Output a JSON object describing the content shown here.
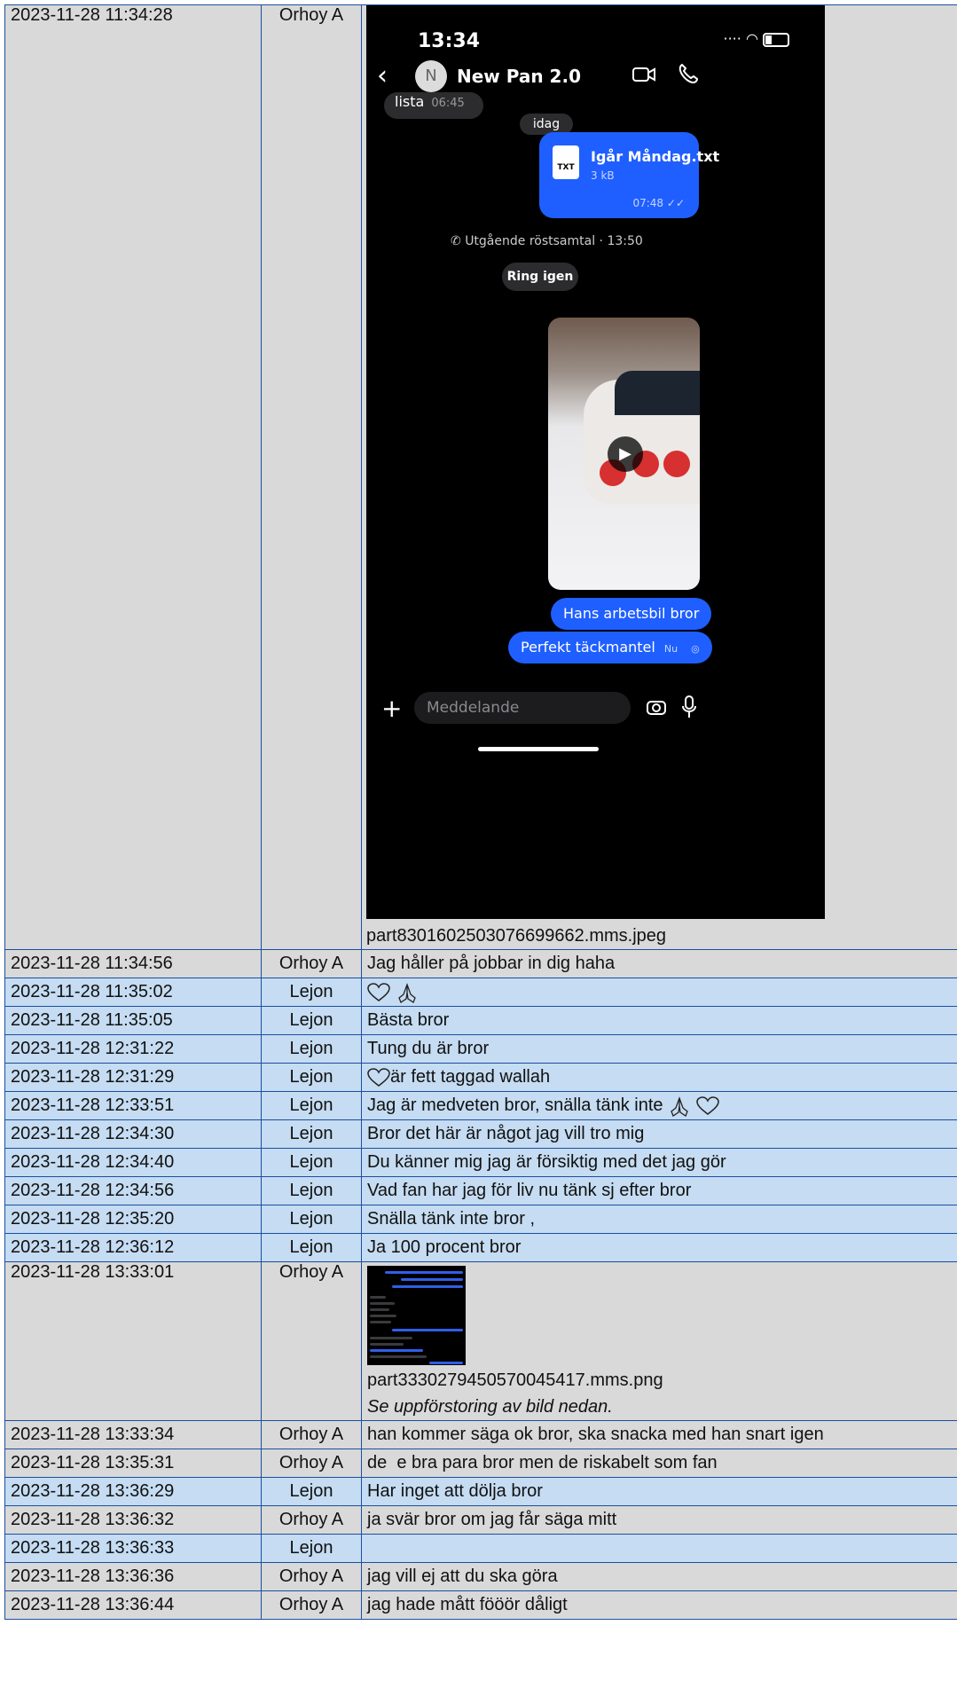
{
  "rows": [
    {
      "time": "2023-11-28 11:34:28",
      "sender": "Orhoy A",
      "text": "part8301602503076699662.mms.jpeg"
    },
    {
      "time": "2023-11-28 11:34:56",
      "sender": "Orhoy A",
      "text": "Jag håller på jobbar in dig haha"
    },
    {
      "time": "2023-11-28 11:35:02",
      "sender": "Lejon",
      "text": ""
    },
    {
      "time": "2023-11-28 11:35:05",
      "sender": "Lejon",
      "text": "Bästa bror"
    },
    {
      "time": "2023-11-28 12:31:22",
      "sender": "Lejon",
      "text": "Tung du är bror"
    },
    {
      "time": "2023-11-28 12:31:29",
      "sender": "Lejon",
      "text": "är fett taggad wallah"
    },
    {
      "time": "2023-11-28 12:33:51",
      "sender": "Lejon",
      "text": "Jag är medveten bror, snälla tänk inte"
    },
    {
      "time": "2023-11-28 12:34:30",
      "sender": "Lejon",
      "text": "Bror det här är något jag vill tro mig"
    },
    {
      "time": "2023-11-28 12:34:40",
      "sender": "Lejon",
      "text": "Du känner mig jag är försiktig med det jag gör"
    },
    {
      "time": "2023-11-28 12:34:56",
      "sender": "Lejon",
      "text": "Vad fan har jag för liv nu tänk sj efter bror"
    },
    {
      "time": "2023-11-28 12:35:20",
      "sender": "Lejon",
      "text": "Snälla tänk inte bror ,"
    },
    {
      "time": "2023-11-28 12:36:12",
      "sender": "Lejon",
      "text": "Ja 100 procent bror"
    },
    {
      "time": "2023-11-28 13:33:01",
      "sender": "Orhoy A",
      "text": "part3330279450570045417.mms.png",
      "note": "Se uppförstoring av bild nedan."
    },
    {
      "time": "2023-11-28 13:33:34",
      "sender": "Orhoy A",
      "text": "han kommer säga ok bror, ska snacka med han snart igen"
    },
    {
      "time": "2023-11-28 13:35:31",
      "sender": "Orhoy A",
      "text": "de  e bra para bror men de riskabelt som fan"
    },
    {
      "time": "2023-11-28 13:36:29",
      "sender": "Lejon",
      "text": "Har inget att dölja bror"
    },
    {
      "time": "2023-11-28 13:36:32",
      "sender": "Orhoy A",
      "text": "ja svär bror om jag får säga mitt"
    },
    {
      "time": "2023-11-28 13:36:33",
      "sender": "Lejon",
      "text": ""
    },
    {
      "time": "2023-11-28 13:36:36",
      "sender": "Orhoy A",
      "text": "jag vill ej att du ska göra"
    },
    {
      "time": "2023-11-28 13:36:44",
      "sender": "Orhoy A",
      "text": "jag hade mått fööör dåligt"
    }
  ],
  "phone": {
    "clock": "13:34",
    "contact_initial": "N",
    "contact_name": "New Pan 2.0",
    "prev_message": "lista",
    "prev_time": "06:45",
    "date_chip": "idag",
    "file_badge": "TXT",
    "file_name": "Igår Måndag.txt",
    "file_size": "3 kB",
    "file_time": "07:48",
    "call_info": "Utgående röstsamtal · 13:50",
    "ring_again": "Ring igen",
    "msg_1": "Hans arbetsbil bror",
    "msg_2": "Perfekt täckmantel",
    "msg_2_time": "Nu",
    "composer_placeholder": "Meddelande"
  },
  "colors": {
    "border": "#1a4fa0",
    "row_orhoy": "#d9d9d9",
    "row_lejon": "#c5dcf2",
    "bubble_blue": "#1f5fff"
  }
}
